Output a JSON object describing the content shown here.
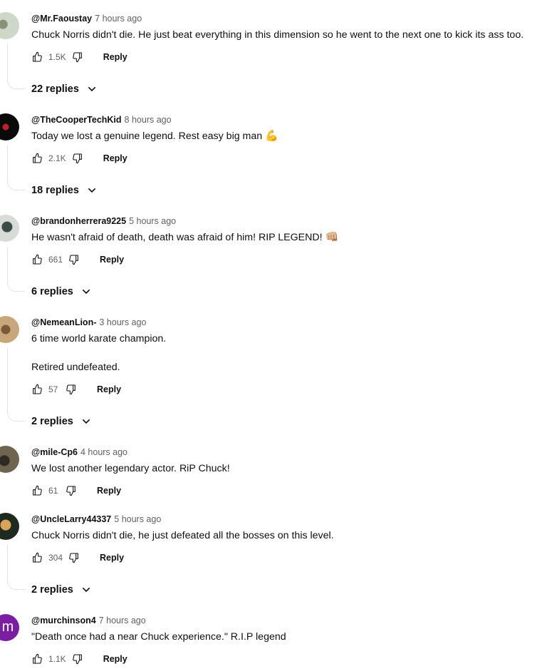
{
  "comments": [
    {
      "author": "@Mr.Faoustay",
      "time": "7 hours ago",
      "text": "Chuck Norris didn't die. He just beat everything in this dimension so he went to the next one to kick its ass too.",
      "likes": "1.5K",
      "reply_label": "Reply",
      "replies": "22 replies",
      "avatar_colors": [
        "#cfd7c8",
        "#6b6f5a"
      ]
    },
    {
      "author": "@TheCooperTechKid",
      "time": "8 hours ago",
      "text": "Today we lost a genuine legend. Rest easy big man",
      "emoji": "💪",
      "likes": "2.1K",
      "reply_label": "Reply",
      "replies": "18 replies",
      "avatar_colors": [
        "#0a0a0a",
        "#c0202a"
      ]
    },
    {
      "author": "@brandonherrera9225",
      "time": "5 hours ago",
      "text": "He wasn't afraid of death, death was afraid of him! RIP LEGEND!",
      "emoji": "👊🏼",
      "likes": "661",
      "reply_label": "Reply",
      "replies": "6 replies",
      "avatar_colors": [
        "#d8dcd8",
        "#3b4b48"
      ]
    },
    {
      "author": "@NemeanLion-",
      "time": "3 hours ago",
      "text": "6 time world karate champion.",
      "text2": "Retired undefeated.",
      "likes": "57",
      "reply_label": "Reply",
      "replies": "2 replies",
      "avatar_colors": [
        "#c9a77a",
        "#7a5a38"
      ]
    },
    {
      "author": "@mile-Cp6",
      "time": "4 hours ago",
      "text": "We lost another legendary actor. RiP Chuck!",
      "likes": "61",
      "reply_label": "Reply",
      "avatar_colors": [
        "#6e6450",
        "#2e2a22"
      ]
    },
    {
      "author": "@UncleLarry44337",
      "time": "5 hours ago",
      "text": "Chuck Norris didn't die, he just defeated all the bosses on this level.",
      "likes": "304",
      "reply_label": "Reply",
      "replies": "2 replies",
      "avatar_colors": [
        "#1f2a1f",
        "#d9a35a"
      ]
    },
    {
      "author": "@murchinson4",
      "time": "7 hours ago",
      "text": "\"Death once had a near Chuck experience.\" R.I.P legend",
      "likes": "1.1K",
      "reply_label": "Reply",
      "avatar_letter": "m",
      "avatar_colors": [
        "#7b1fa2",
        "#ffffff"
      ]
    }
  ]
}
